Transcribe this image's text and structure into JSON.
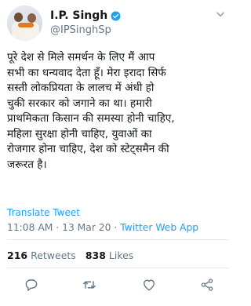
{
  "user": {
    "name": "I.P. Singh",
    "handle": "@IPSinghSp"
  },
  "tweet": {
    "text": "पूरे देश से मिले समर्थन के लिए मैं आप\nसभी का धन्यवाद देता हूँ। मेरा इरादा सिर्फ\nसस्ती लोकप्रियता के लालच में अंधी हो\nचुकी सरकार को जगाने का था। हमारी\nप्राथमिकता किसान की समस्या होनी चाहिए,\nमहिला सुरक्षा होनी चाहिए, युवाओं का\nरोजगार होना चाहिए, देश को स्टेट्समैन की\nजरूरत है।",
    "translate_label": "Translate Tweet",
    "time": "11:08 AM",
    "date": "13 Mar 20",
    "source": "Twitter Web App"
  },
  "stats": {
    "retweets_count": "216",
    "retweets_label": "Retweets",
    "likes_count": "838",
    "likes_label": "Likes"
  },
  "icons": {
    "verified": "verified-badge-icon",
    "more": "chevron-down-icon",
    "reply": "reply-icon",
    "retweet": "retweet-icon",
    "like": "heart-icon",
    "share": "share-icon"
  },
  "colors": {
    "accent": "#1da1f2",
    "muted": "#657786",
    "text": "#14171a"
  }
}
